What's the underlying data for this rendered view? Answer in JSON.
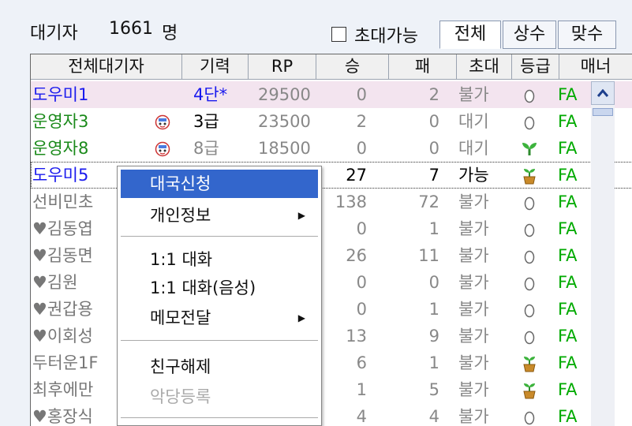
{
  "header": {
    "waiting_label": "대기자",
    "waiting_count": "1661",
    "waiting_unit": "명",
    "invite_checkbox_label": "초대가능",
    "tabs": [
      {
        "label": "전체",
        "active": true
      },
      {
        "label": "상수",
        "active": false
      },
      {
        "label": "맞수",
        "active": false
      }
    ]
  },
  "table": {
    "columns": [
      "전체대기자",
      "기력",
      "RP",
      "승",
      "패",
      "초대",
      "등급",
      "매너"
    ],
    "rows": [
      {
        "name": "도우미1",
        "icon": "",
        "rank": "4단*",
        "rp": "29500",
        "win": "0",
        "loss": "2",
        "invite": "불가",
        "grade": "egg-icon",
        "manner": "FA",
        "name_color": "#1a1aee"
      },
      {
        "name": "운영자3",
        "icon": "badge-icon",
        "rank": "3급",
        "rp": "23500",
        "win": "2",
        "loss": "0",
        "invite": "대기",
        "grade": "egg-icon",
        "manner": "FA",
        "name_color": "#1a8a1a"
      },
      {
        "name": "운영자8",
        "icon": "badge-icon",
        "rank": "8급",
        "rp": "18500",
        "win": "0",
        "loss": "0",
        "invite": "대기",
        "grade": "sprout-icon",
        "manner": "FA",
        "name_color": "#1a8a1a"
      },
      {
        "name": "도우미5",
        "icon": "",
        "rank": "",
        "rp": "",
        "win": "27",
        "loss": "7",
        "invite": "가능",
        "grade": "potted-sprout-icon",
        "manner": "FA",
        "name_color": "#1a1aee"
      },
      {
        "name": "선비민초",
        "icon": "",
        "rank": "",
        "rp": "",
        "win": "138",
        "loss": "72",
        "invite": "불가",
        "grade": "egg-icon",
        "manner": "FA",
        "name_color": "#777777"
      },
      {
        "name": "♥김동엽",
        "icon": "",
        "rank": "",
        "rp": "",
        "win": "0",
        "loss": "1",
        "invite": "불가",
        "grade": "egg-icon",
        "manner": "FA",
        "name_color": "#777777"
      },
      {
        "name": "♥김동면",
        "icon": "",
        "rank": "",
        "rp": "",
        "win": "26",
        "loss": "11",
        "invite": "불가",
        "grade": "egg-icon",
        "manner": "FA",
        "name_color": "#777777"
      },
      {
        "name": "♥김원",
        "icon": "",
        "rank": "",
        "rp": "",
        "win": "0",
        "loss": "0",
        "invite": "불가",
        "grade": "egg-icon",
        "manner": "FA",
        "name_color": "#777777"
      },
      {
        "name": "♥권갑용",
        "icon": "",
        "rank": "",
        "rp": "",
        "win": "0",
        "loss": "1",
        "invite": "불가",
        "grade": "egg-icon",
        "manner": "FA",
        "name_color": "#777777"
      },
      {
        "name": "♥이회성",
        "icon": "",
        "rank": "",
        "rp": "",
        "win": "13",
        "loss": "9",
        "invite": "불가",
        "grade": "egg-icon",
        "manner": "FA",
        "name_color": "#777777"
      },
      {
        "name": "두터운1F",
        "icon": "",
        "rank": "",
        "rp": "",
        "win": "6",
        "loss": "1",
        "invite": "불가",
        "grade": "potted-sprout-icon",
        "manner": "FA",
        "name_color": "#777777"
      },
      {
        "name": "최후에만",
        "icon": "",
        "rank": "",
        "rp": "",
        "win": "1",
        "loss": "5",
        "invite": "불가",
        "grade": "potted-sprout-icon",
        "manner": "FA",
        "name_color": "#777777"
      },
      {
        "name": "♥홍장식",
        "icon": "",
        "rank": "",
        "rp": "",
        "win": "4",
        "loss": "4",
        "invite": "불가",
        "grade": "egg-icon",
        "manner": "FA",
        "name_color": "#777777"
      }
    ]
  },
  "context_menu": {
    "items": [
      {
        "label": "대국신청",
        "highlight": true,
        "submenu": false,
        "disabled": false
      },
      {
        "label": "개인정보",
        "highlight": false,
        "submenu": true,
        "disabled": false
      },
      {
        "label": "1:1 대화",
        "highlight": false,
        "submenu": false,
        "disabled": false
      },
      {
        "label": "1:1 대화(음성)",
        "highlight": false,
        "submenu": false,
        "disabled": false
      },
      {
        "label": "메모전달",
        "highlight": false,
        "submenu": true,
        "disabled": false
      },
      {
        "label": "친구해제",
        "highlight": false,
        "submenu": false,
        "disabled": false
      },
      {
        "label": "악당등록",
        "highlight": false,
        "submenu": false,
        "disabled": true
      }
    ]
  },
  "colors": {
    "selection_row": "#f3e4ef",
    "menu_highlight": "#3366cc",
    "manner_green": "#00aa00"
  }
}
